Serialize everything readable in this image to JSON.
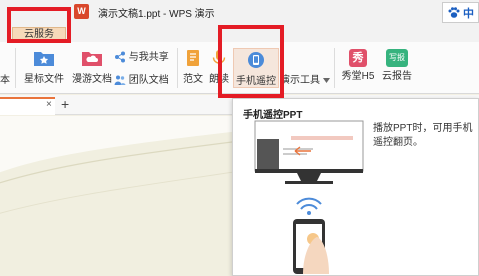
{
  "window": {
    "title": "演示文稿1.ppt - WPS 演示",
    "app_icon_letter": "W",
    "lang_indicator": "中"
  },
  "tabs": {
    "active": "云服务"
  },
  "ribbon": {
    "cut_left": "本",
    "star_doc": "星标文件",
    "roam_doc": "漫游文档",
    "share_with_me": "与我共享",
    "team_doc": "团队文档",
    "template": "范文",
    "reading": "朗读",
    "phone_remote": "手机遥控",
    "presentation_tools": "演示工具",
    "xiutang": "秀堂H5",
    "cloud_report": "云报告",
    "xiu_icon_text": "秀",
    "report_icon_text": "写报"
  },
  "doc_tabs": {
    "close": "×",
    "add": "+"
  },
  "popup": {
    "title": "手机遥控PPT",
    "description": "播放PPT时，可用手机遥控翻页。"
  },
  "colors": {
    "accent": "#e9743c",
    "highlight": "#e41c25",
    "cloud_tab_bg": "#f6d9b9"
  }
}
